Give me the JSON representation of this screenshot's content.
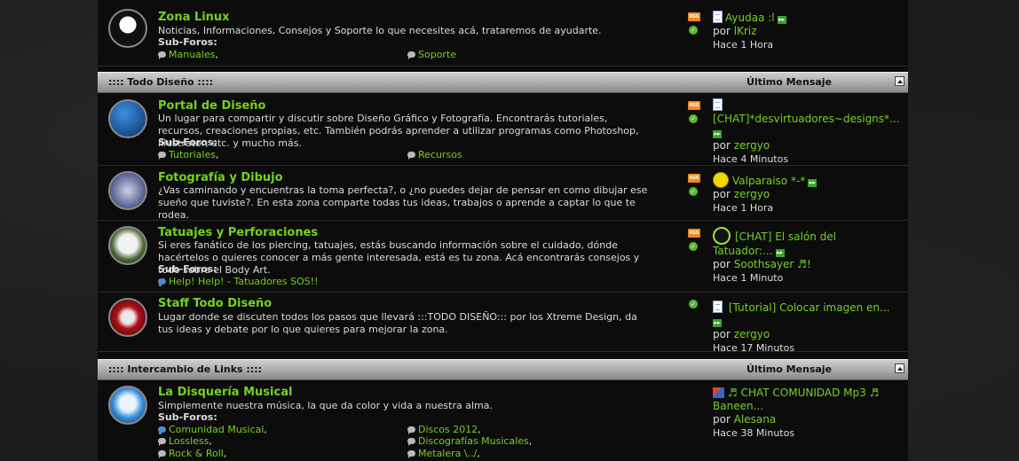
{
  "categories": [
    {
      "name": ":::: Todo Diseño ::::",
      "last_label": "Último Mensaje"
    },
    {
      "name": ":::: Intercambio de Links ::::",
      "last_label": "Último Mensaje"
    }
  ],
  "forums": [
    {
      "title": "Zona Linux",
      "desc": "Noticias, Informaciones, Consejos y Soporte lo que necesites acá, trataremos de ayudarte.",
      "sublabel": "Sub-Foros:",
      "subs": [
        "Manuales",
        "Soporte"
      ],
      "last": {
        "title": "Ayudaa :l",
        "by": "por",
        "user": "lKriz",
        "time": "Hace 1 Hora"
      }
    },
    {
      "title": "Portal de Diseño",
      "desc": "Un lugar para compartir y discutir sobre Diseño Gráfico y Fotografía. Encontrarás tutoriales, recursos, creaciones propias, etc. También podrás aprender a utilizar programas como Photoshop, Illustrator, etc. y mucho más.",
      "sublabel": "Sub-Foros:",
      "subs": [
        "Tutoriales",
        "Recursos"
      ],
      "last": {
        "title": "[CHAT]*desvirtuadores~designs*...",
        "by": "por",
        "user": "zergyo",
        "time": "Hace 4 Minutos"
      }
    },
    {
      "title": "Fotografía y Dibujo",
      "desc": "¿Vas caminando y encuentras la toma perfecta?, o ¿no puedes dejar de pensar en como dibujar ese sueño que tuviste?. En esta zona comparte todas tus ideas, trabajos o aprende a captar lo que te rodea.",
      "last": {
        "title": "Valparaiso *-*",
        "by": "por",
        "user": "zergyo",
        "time": "Hace 1 Hora"
      }
    },
    {
      "title": "Tatuajes y Perforaciones",
      "desc": "Si eres fanático de los piercing, tatuajes, estás buscando información sobre el cuidado, dónde hacértelos o quieres conocer a más gente interesada, está es tu zona. Acá encontrarás consejos y todo sobre el Body Art.",
      "sublabel": "Sub-Foros:",
      "subs": [
        "Help! Help! - Tatuadores SOS!!"
      ],
      "last": {
        "title": "[CHAT] El salón del Tatuador:...",
        "by": "por",
        "user": "Soothsayer ♬!",
        "time": "Hace 1 Minuto"
      }
    },
    {
      "title": "Staff Todo Diseño",
      "desc": "Lugar donde se discuten todos los pasos que llevará :::TODO DISEÑO::: por los Xtreme Design, da tus ideas y debate por lo que quieres para mejorar la zona.",
      "last": {
        "title": "[Tutorial] Colocar imagen en...",
        "by": "por",
        "user": "zergyo",
        "time": "Hace 17 Minutos"
      }
    },
    {
      "title": "La Disquería Musical",
      "desc": "Simplemente nuestra música, la que da color y vida a nuestra alma.",
      "sublabel": "Sub-Foros:",
      "subs": [
        "Comunidad Musical",
        "Discos 2012",
        "Lossless",
        "Discografías Musicales",
        "Rock & Roll",
        "Metalera \\../"
      ],
      "last": {
        "title": "♬ CHAT COMUNIDAD Mp3 ♬ Baneen...",
        "by": "por",
        "user": "Alesana",
        "time": "Hace 38 Minutos"
      }
    }
  ],
  "icons": {
    "rss": "RSS",
    "ok": "✓",
    "go": "▸▸"
  },
  "colors": {
    "link": "#74d21f",
    "rss": "#f08a24",
    "ok": "#5ab82f"
  }
}
